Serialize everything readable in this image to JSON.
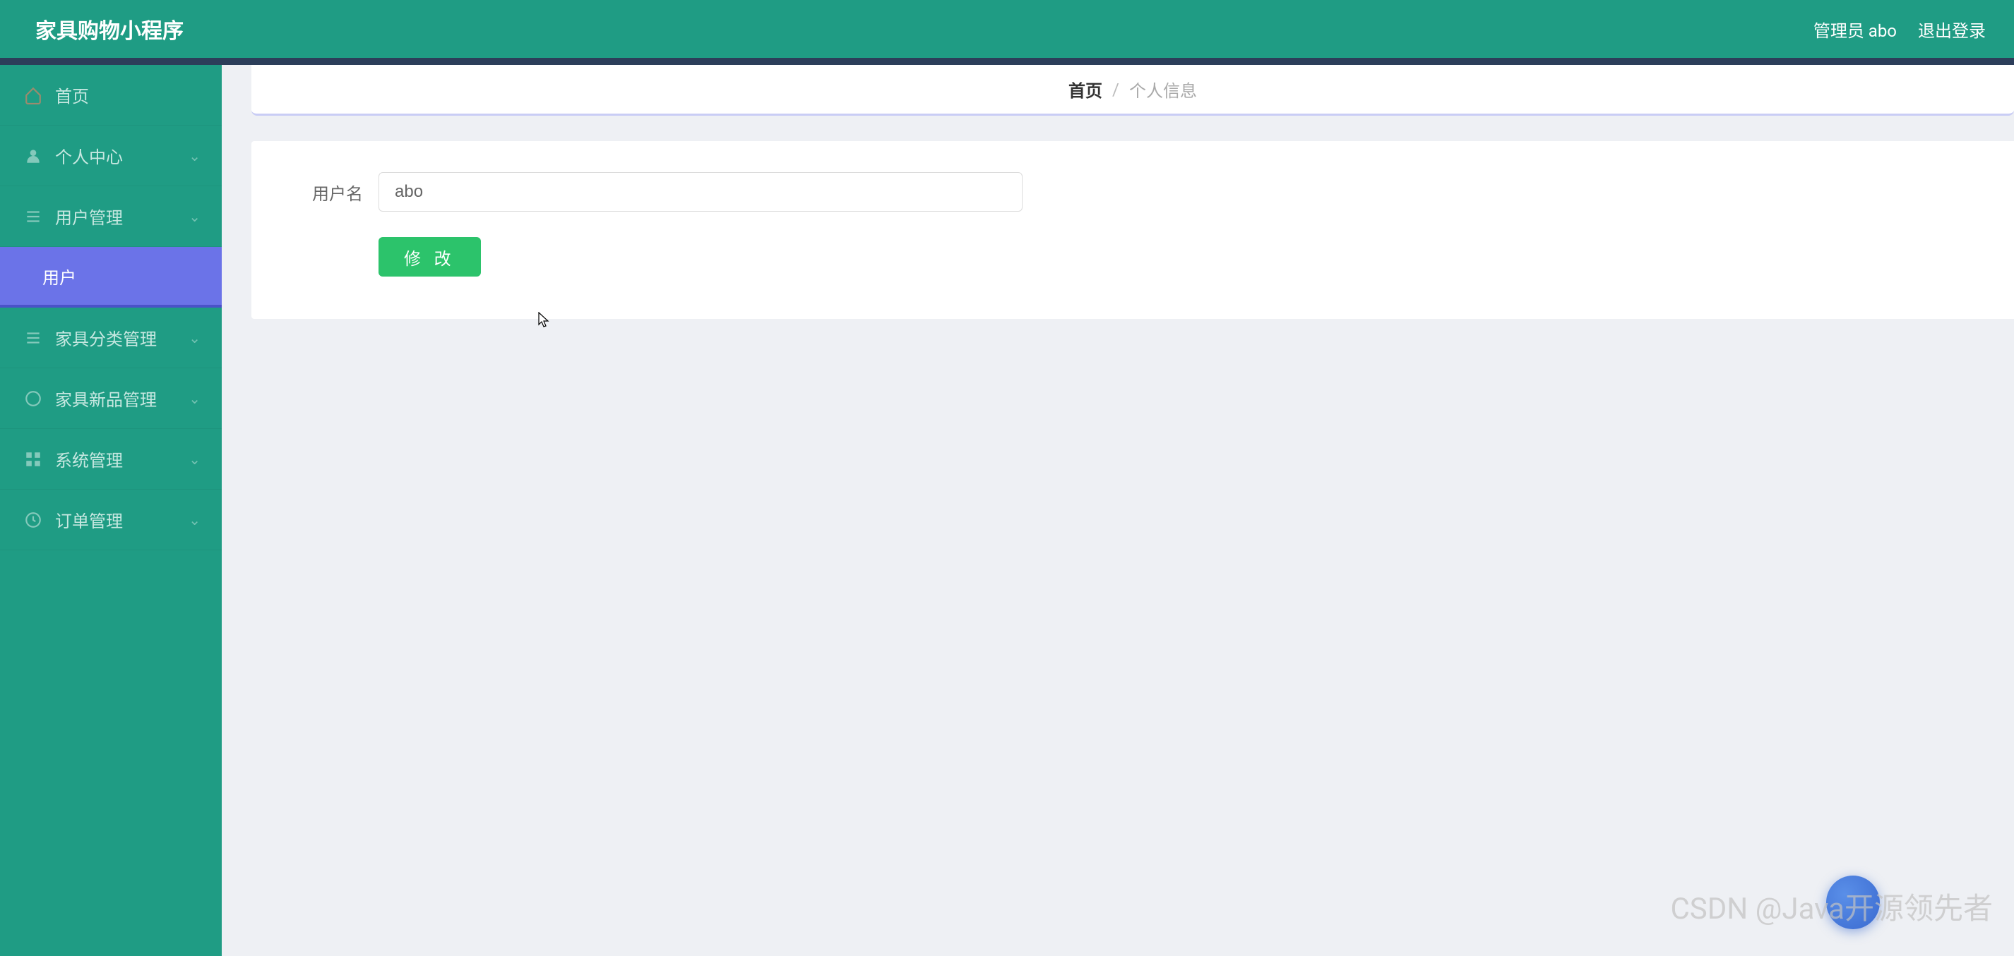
{
  "header": {
    "title": "家具购物小程序",
    "admin_label": "管理员 abo",
    "logout_label": "退出登录"
  },
  "sidebar": {
    "items": [
      {
        "icon": "home",
        "label": "首页",
        "has_arrow": false,
        "active": false
      },
      {
        "icon": "user",
        "label": "个人中心",
        "has_arrow": true,
        "active": false
      },
      {
        "icon": "list",
        "label": "用户管理",
        "has_arrow": true,
        "active": false
      },
      {
        "icon": "",
        "label": "用户",
        "has_arrow": false,
        "active": true,
        "sub": true
      },
      {
        "icon": "list",
        "label": "家具分类管理",
        "has_arrow": true,
        "active": false
      },
      {
        "icon": "circle",
        "label": "家具新品管理",
        "has_arrow": true,
        "active": false
      },
      {
        "icon": "grid",
        "label": "系统管理",
        "has_arrow": true,
        "active": false
      },
      {
        "icon": "clock",
        "label": "订单管理",
        "has_arrow": true,
        "active": false
      }
    ]
  },
  "breadcrumb": {
    "home": "首页",
    "current": "个人信息"
  },
  "form": {
    "username_label": "用户名",
    "username_value": "abo",
    "submit_label": "修 改"
  },
  "watermark": "CSDN @Java开源领先者"
}
